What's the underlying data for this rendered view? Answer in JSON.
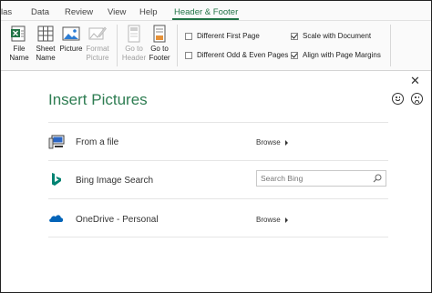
{
  "ribbon": {
    "tabs": [
      {
        "label": "las",
        "active": false
      },
      {
        "label": "Data",
        "active": false
      },
      {
        "label": "Review",
        "active": false
      },
      {
        "label": "View",
        "active": false
      },
      {
        "label": "Help",
        "active": false
      },
      {
        "label": "Header & Footer",
        "active": true
      }
    ],
    "buttons": {
      "file_name": {
        "line1": "File",
        "line2": "Name",
        "icon": "file-name-icon"
      },
      "sheet_name": {
        "line1": "Sheet",
        "line2": "Name",
        "icon": "sheet-name-icon"
      },
      "picture": {
        "line1": "Picture",
        "line2": "",
        "icon": "picture-icon"
      },
      "format_picture": {
        "line1": "Format",
        "line2": "Picture",
        "icon": "format-picture-icon",
        "disabled": true
      },
      "go_to_header": {
        "line1": "Go to",
        "line2": "Header",
        "icon": "go-to-header-icon",
        "disabled": true
      },
      "go_to_footer": {
        "line1": "Go to",
        "line2": "Footer",
        "icon": "go-to-footer-icon"
      }
    },
    "options": {
      "different_first_page": {
        "label": "Different First Page",
        "checked": false
      },
      "different_odd_even": {
        "label": "Different Odd & Even Pages",
        "checked": false
      },
      "scale_with_document": {
        "label": "Scale with Document",
        "checked": true
      },
      "align_with_margins": {
        "label": "Align with Page Margins",
        "checked": true
      }
    }
  },
  "dialog": {
    "title": "Insert Pictures",
    "close_icon": "close-icon",
    "feedback": {
      "happy": "smile-icon",
      "sad": "frown-icon"
    },
    "sources": [
      {
        "label": "From a file",
        "action": "Browse",
        "icon": "computer-icon"
      },
      {
        "label": "Bing Image Search",
        "search_placeholder": "Search Bing",
        "icon": "bing-icon"
      },
      {
        "label": "OneDrive - Personal",
        "action": "Browse",
        "icon": "onedrive-icon"
      }
    ]
  },
  "colors": {
    "accent": "#217346",
    "title": "#2e7d52",
    "bing": "#008373",
    "onedrive": "#0364b8"
  }
}
